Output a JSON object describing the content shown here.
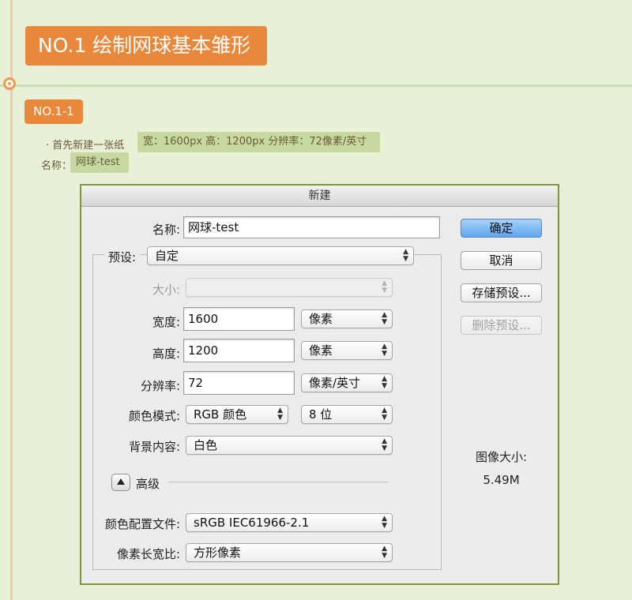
{
  "header": {
    "title": "NO.1  绘制网球基本雏形",
    "step": "NO.1-1"
  },
  "notes": {
    "line1_prefix": "· 首先新建一张纸",
    "line1_highlight": "宽：1600px  高：1200px  分辨率：72像素/英寸",
    "line2_label": "名称：",
    "line2_highlight": "网球-test"
  },
  "dialog": {
    "title": "新建",
    "name_label": "名称:",
    "name_value": "网球-test",
    "preset_label": "预设:",
    "preset_value": "自定",
    "size_label": "大小:",
    "size_value": "",
    "width_label": "宽度:",
    "width_value": "1600",
    "width_unit": "像素",
    "height_label": "高度:",
    "height_value": "1200",
    "height_unit": "像素",
    "resolution_label": "分辨率:",
    "resolution_value": "72",
    "resolution_unit": "像素/英寸",
    "color_mode_label": "颜色模式:",
    "color_mode_value": "RGB 颜色",
    "bit_depth_value": "8 位",
    "background_label": "背景内容:",
    "background_value": "白色",
    "advanced_label": "高级",
    "color_profile_label": "颜色配置文件:",
    "color_profile_value": "sRGB IEC61966-2.1",
    "pixel_aspect_label": "像素长宽比:",
    "pixel_aspect_value": "方形像素",
    "ok_button": "确定",
    "cancel_button": "取消",
    "save_preset_button": "存储预设...",
    "delete_preset_button": "删除预设...",
    "image_size_label": "图像大小:",
    "image_size_value": "5.49M"
  },
  "icons": {
    "dropdown": "updown-arrows-icon",
    "disclosure": "disclosure-triangle-icon"
  },
  "colors": {
    "accent_orange": "#e9883a",
    "highlight_green": "#c6d9a0",
    "dialog_border": "#7a9a3a",
    "primary_button": "#5ca4ee"
  }
}
